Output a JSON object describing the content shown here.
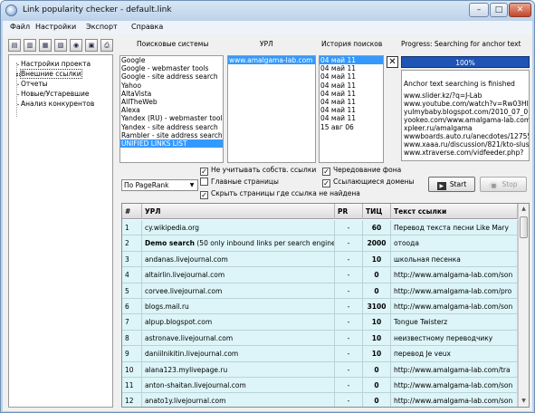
{
  "window": {
    "title": "Link popularity checker - default.link",
    "minimize": "–",
    "maximize": "□",
    "close": "✕"
  },
  "menu": [
    "Файл",
    "Настройки",
    "Экспорт",
    "Справка"
  ],
  "toolbar": {
    "icons": [
      "new-file-icon",
      "open-icon",
      "open-recent-icon",
      "save-icon",
      "search-icon",
      "export-icon",
      "print-icon"
    ]
  },
  "tree": {
    "items": [
      {
        "label": "Настройки проекта",
        "selected": false
      },
      {
        "label": "Внешние ссылки",
        "selected": true
      },
      {
        "label": "Отчеты",
        "selected": false
      },
      {
        "label": "Новые/Устаревшие",
        "selected": false
      },
      {
        "label": "Анализ конкурентов",
        "selected": false
      }
    ]
  },
  "search_engines": {
    "label": "Поисковые системы",
    "items": [
      {
        "label": "Google",
        "selected": false
      },
      {
        "label": "Google - webmaster tools",
        "selected": false
      },
      {
        "label": "Google - site address search",
        "selected": false
      },
      {
        "label": "Yahoo",
        "selected": false
      },
      {
        "label": "AltaVista",
        "selected": false
      },
      {
        "label": "AllTheWeb",
        "selected": false
      },
      {
        "label": "Alexa",
        "selected": false
      },
      {
        "label": "Yandex (RU) - webmaster tools",
        "selected": false
      },
      {
        "label": "Yandex - site address search",
        "selected": false
      },
      {
        "label": "Rambler - site address search",
        "selected": false
      },
      {
        "label": "UNIFIED LINKS LIST",
        "selected": true
      }
    ]
  },
  "urls": {
    "label": "УРЛ",
    "items": [
      {
        "label": "www.amalgama-lab.com",
        "selected": true
      }
    ]
  },
  "history": {
    "label": "История поисков",
    "items": [
      {
        "label": "04 май 11",
        "selected": true
      },
      {
        "label": "04 май 11",
        "selected": false
      },
      {
        "label": "04 май 11",
        "selected": false
      },
      {
        "label": "04 май 11",
        "selected": false
      },
      {
        "label": "04 май 11",
        "selected": false
      },
      {
        "label": "04 май 11",
        "selected": false
      },
      {
        "label": "04 май 11",
        "selected": false
      },
      {
        "label": "04 май 11",
        "selected": false
      },
      {
        "label": "15 авг 06",
        "selected": false
      }
    ]
  },
  "progress": {
    "label": "Progress: Searching for anchor text",
    "text": "100%",
    "value": 1.0
  },
  "delete_button": "✕",
  "log": [
    "Anchor text searching is finished",
    "www.slider.kz/?q=J-Lab",
    "www.youtube.com/watch?v=Rw03HI",
    "yulmybaby.blogspot.com/2010_07_01",
    "yookeo.com/www.amalgama-lab.com",
    "xpleer.ru/amalgama",
    "wwwboards.auto.ru/anecdotes/12755",
    "www.xaaa.ru/discussion/821/kto-slus",
    "www.xtraverse.com/vidfeeder.php?"
  ],
  "options": {
    "ignore_own_links": {
      "label": "Не учитывать собств. ссылки",
      "checked": true
    },
    "main_pages": {
      "label": "Главные страницы",
      "checked": false
    },
    "hide_not_found": {
      "label": "Скрыть страницы где ссылка не найдена",
      "checked": true
    },
    "alternate_bg": {
      "label": "Чередование фона",
      "checked": true
    },
    "referring_domains": {
      "label": "Ссылающиеся домены",
      "checked": true
    }
  },
  "sort": {
    "selected": "По PageRank"
  },
  "buttons": {
    "start": "Start",
    "stop": "Stop"
  },
  "table": {
    "columns": [
      "#",
      "УРЛ",
      "PR",
      "ТИЦ",
      "Текст ссылки"
    ],
    "rows": [
      {
        "num": "1",
        "url": "cy.wikipedia.org",
        "url_bold": "",
        "url_rest": "",
        "pr": "-",
        "tic": "60",
        "anchor": "Перевод текста песни Like Mary"
      },
      {
        "num": "2",
        "url": "",
        "url_bold": "Demo search",
        "url_rest": " (50 only inbound links per search engine)",
        "pr": "-",
        "tic": "2000",
        "anchor": "отоода"
      },
      {
        "num": "3",
        "url": "andanas.livejournal.com",
        "url_bold": "",
        "url_rest": "",
        "pr": "-",
        "tic": "10",
        "anchor": "школьная песенка"
      },
      {
        "num": "4",
        "url": "altairlin.livejournal.com",
        "url_bold": "",
        "url_rest": "",
        "pr": "-",
        "tic": "0",
        "anchor": "http://www.amalgama-lab.com/son"
      },
      {
        "num": "5",
        "url": "corvee.livejournal.com",
        "url_bold": "",
        "url_rest": "",
        "pr": "-",
        "tic": "0",
        "anchor": "http://www.amalgama-lab.com/pro"
      },
      {
        "num": "6",
        "url": "blogs.mail.ru",
        "url_bold": "",
        "url_rest": "",
        "pr": "-",
        "tic": "3100",
        "anchor": "http://www.amalgama-lab.com/son"
      },
      {
        "num": "7",
        "url": "alpup.blogspot.com",
        "url_bold": "",
        "url_rest": "",
        "pr": "-",
        "tic": "10",
        "anchor": "Tongue Twisterz"
      },
      {
        "num": "8",
        "url": "astronave.livejournal.com",
        "url_bold": "",
        "url_rest": "",
        "pr": "-",
        "tic": "10",
        "anchor": "неизвестному переводчику"
      },
      {
        "num": "9",
        "url": "daniilnikitin.livejournal.com",
        "url_bold": "",
        "url_rest": "",
        "pr": "-",
        "tic": "10",
        "anchor": "перевод Je veux"
      },
      {
        "num": "10",
        "url": "alana123.mylivepage.ru",
        "url_bold": "",
        "url_rest": "",
        "pr": "-",
        "tic": "0",
        "anchor": "http://www.amalgama-lab.com/tra"
      },
      {
        "num": "11",
        "url": "anton-shaitan.livejournal.com",
        "url_bold": "",
        "url_rest": "",
        "pr": "-",
        "tic": "0",
        "anchor": "http://www.amalgama-lab.com/son"
      },
      {
        "num": "12",
        "url": "anato1y.livejournal.com",
        "url_bold": "",
        "url_rest": "",
        "pr": "-",
        "tic": "0",
        "anchor": "http://www.amalgama-lab.com/son"
      }
    ]
  },
  "scrollbar": {
    "up": "▲",
    "down": "▼"
  }
}
